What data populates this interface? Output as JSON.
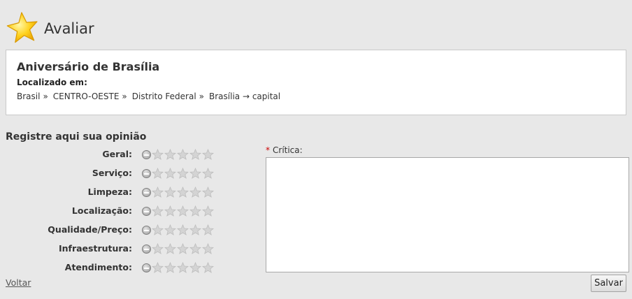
{
  "header": {
    "title": "Avaliar",
    "icon": "star-logo-icon"
  },
  "event": {
    "name": "Aniversário de Brasília",
    "located_label": "Localizado em:",
    "breadcrumb": [
      "Brasil",
      "CENTRO-OESTE",
      "Distrito Federal",
      "Brasília → capital"
    ],
    "separator": "»"
  },
  "opinion": {
    "title": "Registre aqui sua opinião",
    "categories": [
      {
        "label": "Geral:",
        "rating": 0
      },
      {
        "label": "Serviço:",
        "rating": 0
      },
      {
        "label": "Limpeza:",
        "rating": 0
      },
      {
        "label": "Localização:",
        "rating": 0
      },
      {
        "label": "Qualidade/Preço:",
        "rating": 0
      },
      {
        "label": "Infraestrutura:",
        "rating": 0
      },
      {
        "label": "Atendimento:",
        "rating": 0
      }
    ],
    "max_rating": 5
  },
  "review": {
    "required_mark": "*",
    "label": "Crítica:",
    "value": ""
  },
  "footer": {
    "back_link": "Voltar",
    "save_label": "Salvar"
  },
  "colors": {
    "required": "#cc0000",
    "star_empty": "#d4d4d4",
    "logo_star": "#ffd21f"
  }
}
